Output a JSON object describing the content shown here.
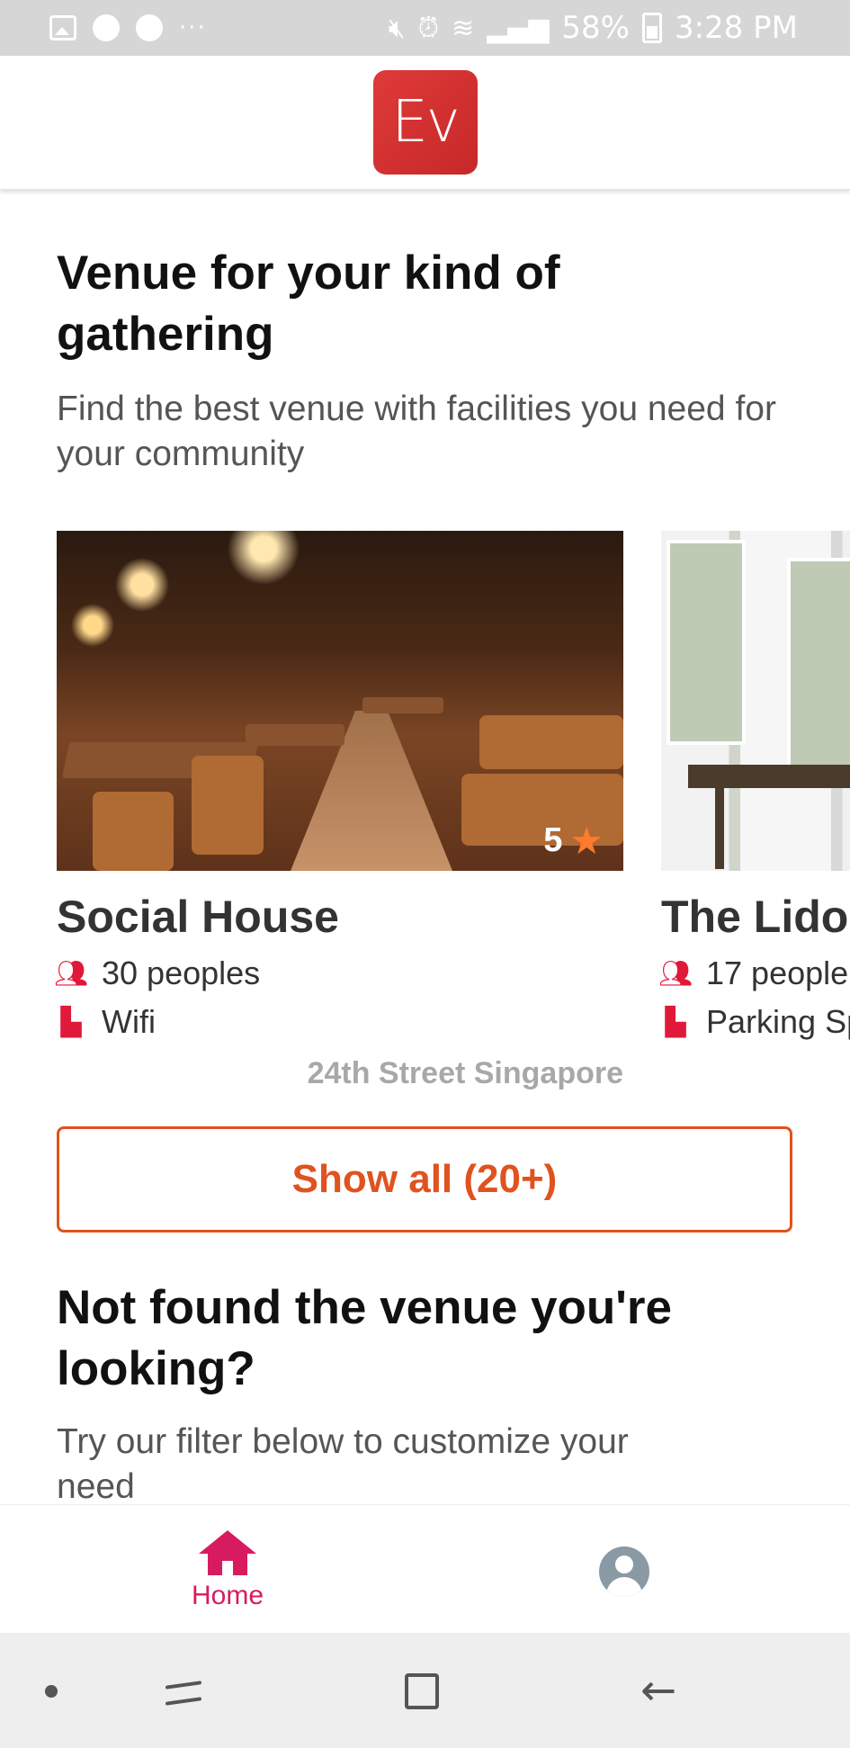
{
  "status_bar": {
    "battery": "58%",
    "time": "3:28 PM",
    "overflow": "···"
  },
  "header": {
    "logo_text": "Ev"
  },
  "main": {
    "title": "Venue for your kind of gathering",
    "subtitle": "Find the best venue with facilities you need for your community",
    "venues": [
      {
        "name": "Social House",
        "rating": "5",
        "capacity": "30 peoples",
        "facility": "Wifi",
        "address": "24th Street Singapore"
      },
      {
        "name": "The Lido",
        "capacity": "17 people",
        "facility": "Parking Sp"
      }
    ],
    "show_all_label": "Show all (20+)",
    "not_found_title": "Not found the venue you're looking?",
    "not_found_sub": "Try our filter below to customize your need"
  },
  "bottom_nav": {
    "home_label": "Home"
  },
  "colors": {
    "brand_red": "#d32f2f",
    "accent_orange": "#e0521e",
    "nav_active": "#d81b60",
    "icon_red": "#e0193a",
    "star_orange": "#ff7a2f"
  },
  "icons": {
    "capacity": "users-icon",
    "facility": "seat-icon",
    "rating": "star-icon",
    "home": "home-icon",
    "profile": "user-circle-icon"
  }
}
